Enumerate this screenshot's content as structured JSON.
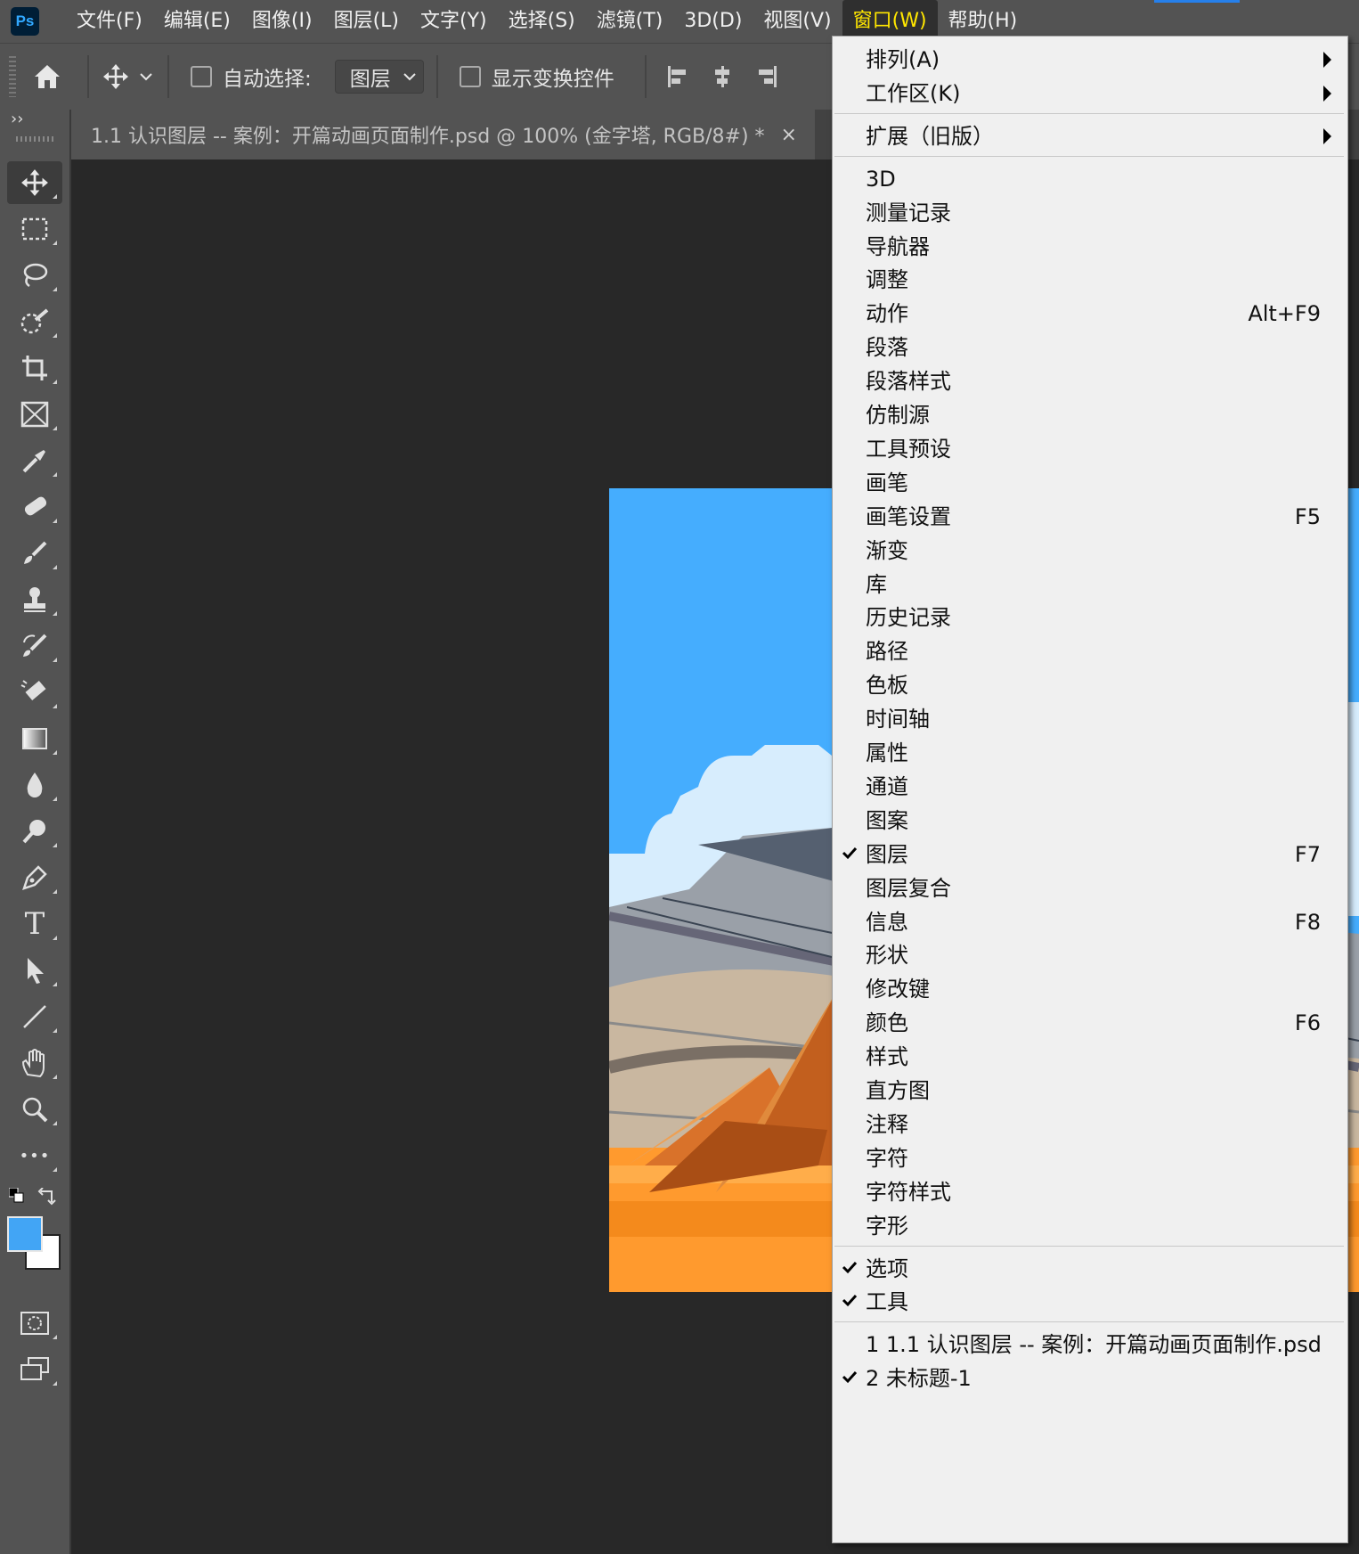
{
  "app": {
    "logo": "Ps"
  },
  "menubar": {
    "items": [
      {
        "label": "文件(F)",
        "active": false
      },
      {
        "label": "编辑(E)",
        "active": false
      },
      {
        "label": "图像(I)",
        "active": false
      },
      {
        "label": "图层(L)",
        "active": false
      },
      {
        "label": "文字(Y)",
        "active": false
      },
      {
        "label": "选择(S)",
        "active": false
      },
      {
        "label": "滤镜(T)",
        "active": false
      },
      {
        "label": "3D(D)",
        "active": false
      },
      {
        "label": "视图(V)",
        "active": false
      },
      {
        "label": "窗口(W)",
        "active": true
      },
      {
        "label": "帮助(H)",
        "active": false
      }
    ]
  },
  "options": {
    "auto_select_label": "自动选择:",
    "auto_select_checked": false,
    "layer_select_value": "图层",
    "show_transform_label": "显示变换控件",
    "show_transform_checked": false
  },
  "document_tab": {
    "title": "1.1 认识图层 -- 案例：开篇动画页面制作.psd @ 100% (金字塔, RGB/8#) *",
    "close": "×"
  },
  "toolbar": {
    "collapse_glyph": "››",
    "tools": [
      {
        "name": "move-tool",
        "icon": "move-icon",
        "selected": true
      },
      {
        "name": "marquee-tool",
        "icon": "rectangular-marquee-icon"
      },
      {
        "name": "lasso-tool",
        "icon": "lasso-icon"
      },
      {
        "name": "quick-selection-tool",
        "icon": "quick-selection-icon"
      },
      {
        "name": "crop-tool",
        "icon": "crop-icon"
      },
      {
        "name": "frame-tool",
        "icon": "frame-icon"
      },
      {
        "name": "eyedropper-tool",
        "icon": "eyedropper-icon"
      },
      {
        "name": "healing-brush-tool",
        "icon": "bandage-icon"
      },
      {
        "name": "brush-tool",
        "icon": "brush-icon"
      },
      {
        "name": "clone-stamp-tool",
        "icon": "stamp-icon"
      },
      {
        "name": "history-brush-tool",
        "icon": "history-brush-icon"
      },
      {
        "name": "eraser-tool",
        "icon": "eraser-icon"
      },
      {
        "name": "gradient-tool",
        "icon": "gradient-icon"
      },
      {
        "name": "blur-tool",
        "icon": "drop-icon"
      },
      {
        "name": "dodge-tool",
        "icon": "dodge-icon"
      },
      {
        "name": "pen-tool",
        "icon": "pen-icon"
      },
      {
        "name": "type-tool",
        "icon": "type-icon"
      },
      {
        "name": "path-selection-tool",
        "icon": "arrow-icon"
      },
      {
        "name": "line-tool",
        "icon": "line-icon"
      },
      {
        "name": "hand-tool",
        "icon": "hand-icon"
      },
      {
        "name": "zoom-tool",
        "icon": "zoom-icon"
      },
      {
        "name": "edit-toolbar",
        "icon": "more-icon"
      }
    ],
    "type_glyph": "T",
    "more_glyph": "•••",
    "foreground_color": "#42a5f5",
    "background_color": "#ffffff"
  },
  "window_menu": {
    "group1": [
      {
        "label": "排列(A)",
        "submenu": true
      },
      {
        "label": "工作区(K)",
        "submenu": true
      }
    ],
    "group2": [
      {
        "label": "扩展（旧版）",
        "submenu": true
      }
    ],
    "group3": [
      {
        "label": "3D"
      },
      {
        "label": "测量记录"
      },
      {
        "label": "导航器"
      },
      {
        "label": "调整"
      },
      {
        "label": "动作",
        "shortcut": "Alt+F9"
      },
      {
        "label": "段落"
      },
      {
        "label": "段落样式"
      },
      {
        "label": "仿制源"
      },
      {
        "label": "工具预设"
      },
      {
        "label": "画笔"
      },
      {
        "label": "画笔设置",
        "shortcut": "F5"
      },
      {
        "label": "渐变"
      },
      {
        "label": "库"
      },
      {
        "label": "历史记录"
      },
      {
        "label": "路径"
      },
      {
        "label": "色板"
      },
      {
        "label": "时间轴"
      },
      {
        "label": "属性"
      },
      {
        "label": "通道"
      },
      {
        "label": "图案"
      },
      {
        "label": "图层",
        "shortcut": "F7",
        "checked": true,
        "highlighted": true
      },
      {
        "label": "图层复合"
      },
      {
        "label": "信息",
        "shortcut": "F8"
      },
      {
        "label": "形状"
      },
      {
        "label": "修改键"
      },
      {
        "label": "颜色",
        "shortcut": "F6"
      },
      {
        "label": "样式"
      },
      {
        "label": "直方图"
      },
      {
        "label": "注释"
      },
      {
        "label": "字符"
      },
      {
        "label": "字符样式"
      },
      {
        "label": "字形"
      }
    ],
    "group4": [
      {
        "label": "选项",
        "checked": true
      },
      {
        "label": "工具",
        "checked": true
      }
    ],
    "group5": [
      {
        "label": "1 1.1 认识图层 -- 案例：开篇动画页面制作.psd"
      },
      {
        "label": "2 未标题-1",
        "checked": true
      }
    ]
  },
  "colors": {
    "sky": "#45adfe",
    "sand": "#ff9a2e",
    "highlight": "#ffff00",
    "menu_active_text": "#ffe600"
  }
}
